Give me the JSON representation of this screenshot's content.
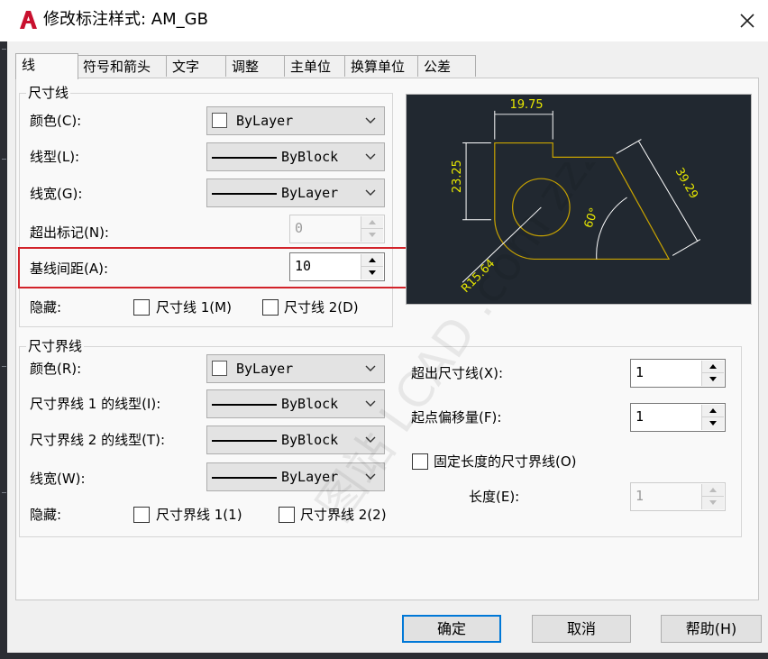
{
  "window": {
    "title": "修改标注样式: AM_GB",
    "app_icon": "autocad-a-icon",
    "close_icon": "close-icon"
  },
  "tabs": [
    "线",
    "符号和箭头",
    "文字",
    "调整",
    "主单位",
    "换算单位",
    "公差"
  ],
  "dim_lines": {
    "title": "尺寸线",
    "color_label": "颜色(C):",
    "color_value": "ByLayer",
    "linetype_label": "线型(L):",
    "linetype_value": "ByBlock",
    "lineweight_label": "线宽(G):",
    "lineweight_value": "ByLayer",
    "extend_label": "超出标记(N):",
    "extend_value": "0",
    "baseline_label": "基线间距(A):",
    "baseline_value": "10",
    "suppress_label": "隐藏:",
    "suppress1": "尺寸线 1(M)",
    "suppress2": "尺寸线 2(D)"
  },
  "ext_lines": {
    "title": "尺寸界线",
    "color_label": "颜色(R):",
    "color_value": "ByLayer",
    "lt1_label": "尺寸界线 1 的线型(I):",
    "lt1_value": "ByBlock",
    "lt2_label": "尺寸界线 2 的线型(T):",
    "lt2_value": "ByBlock",
    "lw_label": "线宽(W):",
    "lw_value": "ByLayer",
    "suppress_label": "隐藏:",
    "suppress1": "尺寸界线 1(1)",
    "suppress2": "尺寸界线 2(2)",
    "beyond_label": "超出尺寸线(X):",
    "beyond_value": "1",
    "offset_label": "起点偏移量(F):",
    "offset_value": "1",
    "fixed_label": "固定长度的尺寸界线(O)",
    "length_label": "长度(E):",
    "length_value": "1"
  },
  "preview": {
    "dim_top": "19.75",
    "dim_left": "23.25",
    "dim_right": "39.29",
    "angle": "60°",
    "radius": "R15.64"
  },
  "watermark": "图站 LCAD .com zzzcad",
  "buttons": {
    "ok": "确定",
    "cancel": "取消",
    "help": "帮助(H)"
  }
}
